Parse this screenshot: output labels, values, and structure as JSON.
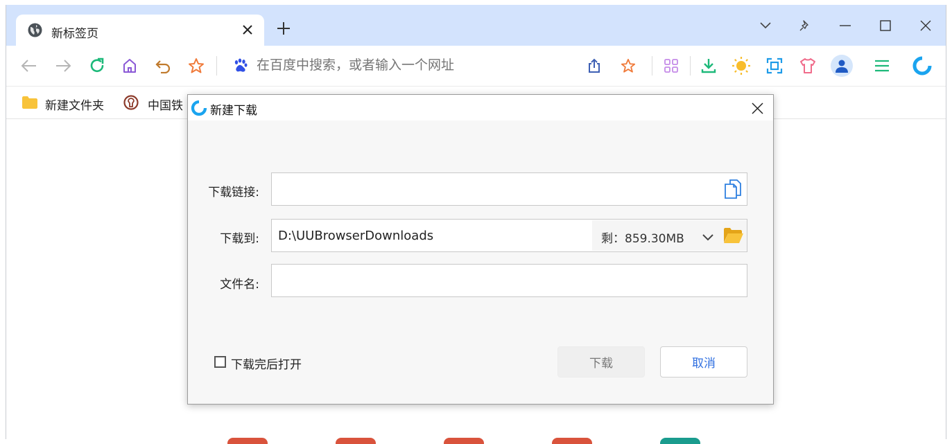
{
  "browser": {
    "tab": {
      "title": "新标签页"
    },
    "address_bar": {
      "placeholder": "在百度中搜索，或者输入一个网址"
    },
    "bookmarks": [
      {
        "label": "新建文件夹",
        "icon": "folder-icon"
      },
      {
        "label": "中国铁",
        "icon": "railway-logo-icon"
      }
    ]
  },
  "dialog": {
    "title": "新建下载",
    "link_label": "下载链接:",
    "link_value": "",
    "save_to_label": "下载到:",
    "save_to_value": "D:\\UUBrowserDownloads",
    "free_space": "剩：859.30MB",
    "filename_label": "文件名:",
    "filename_value": "",
    "open_after_label": "下载完后打开",
    "open_after_checked": false,
    "download_button": "下载",
    "cancel_button": "取消"
  },
  "colors": {
    "titlebar": "#d3e3fd",
    "accent_blue": "#2f6fe0",
    "refresh_green": "#1db97a",
    "folder_yellow": "#f8c33a"
  }
}
